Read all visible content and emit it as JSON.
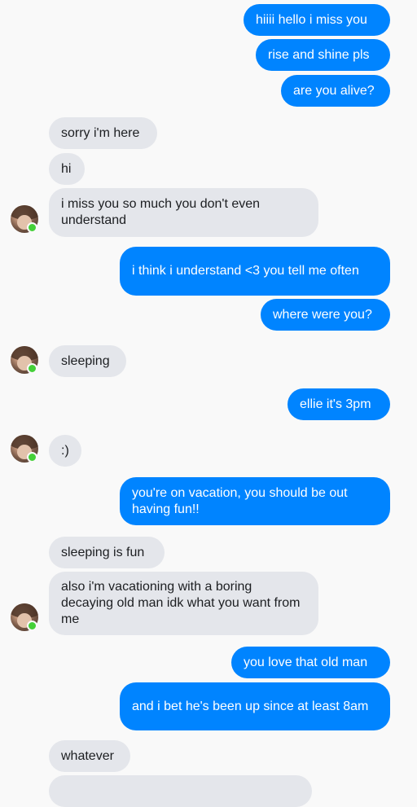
{
  "colors": {
    "outgoing_bubble": "#0084ff",
    "incoming_bubble": "#e4e6eb",
    "background": "#f9f9f9",
    "online_indicator": "#44d038"
  },
  "messages": [
    {
      "sender": "me",
      "text": "hiiii hello i miss you"
    },
    {
      "sender": "me",
      "text": "rise and shine pls"
    },
    {
      "sender": "me",
      "text": "are you alive?"
    },
    {
      "sender": "them",
      "text": "sorry i'm here"
    },
    {
      "sender": "them",
      "text": "hi"
    },
    {
      "sender": "them",
      "text": "i miss you so much you don't even understand"
    },
    {
      "sender": "me",
      "text": "i think i understand <3 you tell me often"
    },
    {
      "sender": "me",
      "text": "where were you?"
    },
    {
      "sender": "them",
      "text": "sleeping"
    },
    {
      "sender": "me",
      "text": "ellie it's 3pm"
    },
    {
      "sender": "them",
      "text": ":)"
    },
    {
      "sender": "me",
      "text": "you're on vacation, you should be out having fun!!"
    },
    {
      "sender": "them",
      "text": "sleeping is fun"
    },
    {
      "sender": "them",
      "text": "also i'm vacationing with a boring decaying old man idk what you want from me"
    },
    {
      "sender": "me",
      "text": "you love that old man"
    },
    {
      "sender": "me",
      "text": "and i bet he's been up since at least 8am"
    },
    {
      "sender": "them",
      "text": "whatever"
    }
  ],
  "avatar": {
    "icon": "contact-avatar-icon",
    "status": "online"
  }
}
